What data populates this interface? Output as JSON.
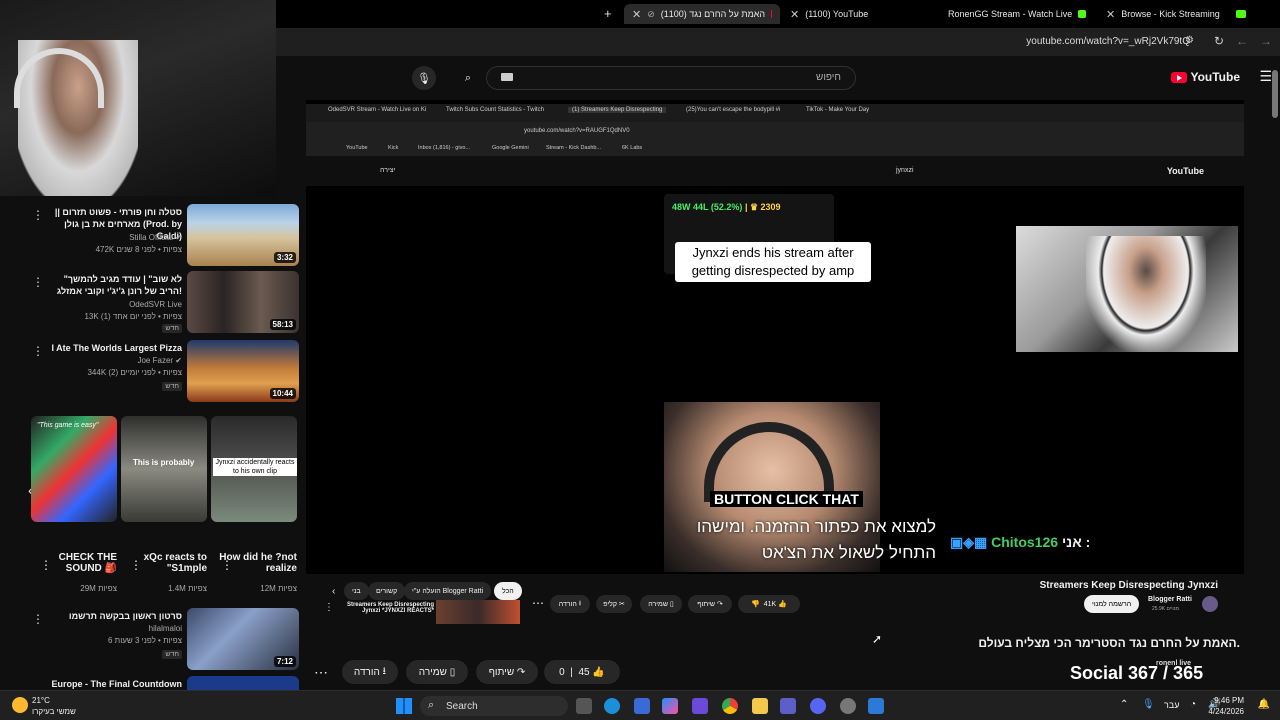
{
  "browser": {
    "tabs": [
      {
        "label": "(1100) האמת על החרם נגד",
        "icon": "youtube-icon",
        "active": true
      },
      {
        "label": "(1100) YouTube",
        "icon": "youtube-icon",
        "active": false
      },
      {
        "label": "RonenGG Stream - Watch Live",
        "icon": "kick-icon",
        "active": false
      },
      {
        "label": "Browse - Kick Streaming",
        "icon": "kick-icon",
        "active": false
      }
    ],
    "url": "youtube.com/watch?v=_wRj2Vk79tQ"
  },
  "youtube": {
    "search_placeholder": "חיפוש",
    "logo": "YouTube"
  },
  "sidebar": {
    "items": [
      {
        "title": "סטלה וחן פורתי - פשוט תזרום || מארחים את בן גולן (Prod. by Galdi)",
        "channel": "Stilla Official",
        "verified": true,
        "meta": "472K צפיות • לפני 8 שנים",
        "duration": "3:32",
        "badge": ""
      },
      {
        "title": "\"לא שוב\" | עודד מגיב להמשך הריב של רונן ג'יג'י וקובי אמזלג!",
        "channel": "OdedSVR Live",
        "verified": false,
        "meta": "13K צפיות • לפני יום אחד (1)",
        "duration": "58:13",
        "badge": "חדש"
      },
      {
        "title": "I Ate The Worlds Largest Pizza",
        "channel": "Joe Fazer",
        "verified": true,
        "meta": "344K צפיות • לפני יומיים (2)",
        "duration": "10:44",
        "badge": "חדש"
      },
      {
        "title": "סרטון ראשון בבקשה תרשמו",
        "channel": "hilalmaloi",
        "verified": false,
        "meta": "6 צפיות • לפני 3 שעות",
        "duration": "7:12",
        "badge": "חדש"
      },
      {
        "title": "Europe - The Final Countdown",
        "channel": "",
        "verified": false,
        "meta": "",
        "duration": "",
        "badge": ""
      }
    ],
    "shorts": [
      {
        "title": "CHECK THE SOUND 🎒",
        "views": "29M צפיות",
        "overlay": "\"This game is easy\""
      },
      {
        "title": "xQc reacts to \"S1mple",
        "views": "1.4M צפיות",
        "overlay": "This is probably"
      },
      {
        "title": "How did he ?not realize",
        "views": "12M צפיות",
        "overlay": "Jynxzi accidentally reacts to his own clip"
      }
    ]
  },
  "video": {
    "inner_tabs": [
      "OdedSVR Stream - Watch Live on Ki",
      "Twitch Subs Count Statistics - Twitch",
      "(1) Streamers Keep Disrespecting",
      "(25)You can't escape the bodypill #i",
      "TikTok - Make Your Day"
    ],
    "inner_url": "youtube.com/watch?v=RAUGF1QdNV0",
    "inner_bookmarks": [
      "YouTube",
      "Kick",
      "Inbox (1,816) - givo...",
      "Google Gemini",
      "Stream - Kick Dashb...",
      "6K Labs"
    ],
    "inner_search": "jynxzi",
    "inner_create": "יצירה",
    "stats": {
      "wins": "48W",
      "losses": "44L",
      "pct": "(52.2%)",
      "lp": "2309"
    },
    "caption_top": "Jynxzi ends his stream after getting disrespected by amp",
    "button_caption": "BUTTON CLICK THAT",
    "subtitle_line1": "למצוא את כפתור ההזמנה.  ומישהו",
    "subtitle_line2": "התחיל לשאול את הצ'אט",
    "chat_prefix": "אני :",
    "chat_user": "Chitos126"
  },
  "under_video": {
    "inner_title": "Streamers Keep Disrespecting Jynxzi",
    "inner_channel": "Blogger Ratti",
    "inner_subs": "25.9K מנויים",
    "inner_subscribe": "הרשמה למנוי",
    "inner_likes": "41K",
    "inner_share": "שיתוף",
    "inner_save": "שמירה",
    "inner_clip": "קליפ",
    "inner_download": "הורדה",
    "inner_chips": [
      "הכל",
      "הועלה ע\"י Blogger Ratti",
      "קשורים",
      "בני"
    ],
    "inner_next_title": "Streamers Keep Disrespecting Jynxzi *JYNXZI REACTS*",
    "main_title": "האמת על החרם נגד הסטרימר הכי מצליח בעולם.",
    "likes": "45",
    "dislikes": "0",
    "share": "שיתוף",
    "save": "שמירה",
    "download": "הורדה",
    "overlay_counter": "Social 367 / 365",
    "overlay_channel": "ronenl live"
  },
  "taskbar": {
    "weather_temp": "21°C",
    "weather_desc": "שמשי בעיקרו",
    "search": "Search",
    "time": "9:46 PM",
    "date": "4/24/2026",
    "lang": "עבר"
  }
}
